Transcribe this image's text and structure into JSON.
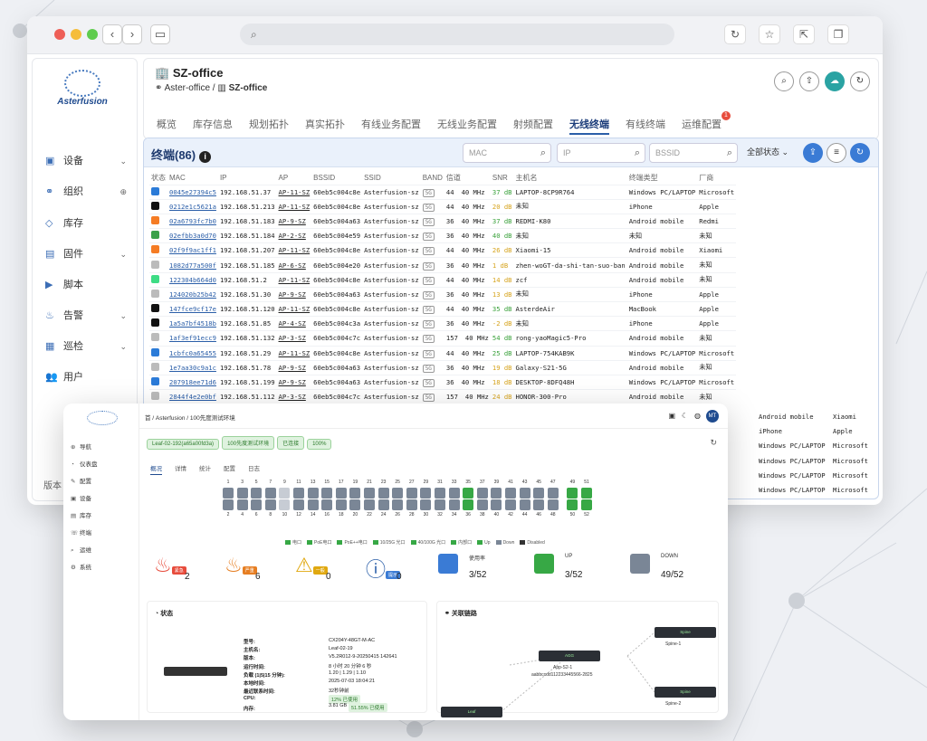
{
  "browser": {
    "url": "",
    "icons": [
      "back-icon",
      "forward-icon",
      "sidebar-icon",
      "reload-icon",
      "star-icon",
      "share-icon",
      "copy-icon"
    ]
  },
  "sidebar": {
    "brand": "Asterfusion",
    "items": [
      {
        "label": "设备",
        "icon": "device-icon",
        "arrow": true
      },
      {
        "label": "组织",
        "icon": "org-icon",
        "plus": true
      },
      {
        "label": "库存",
        "icon": "tag-icon"
      },
      {
        "label": "固件",
        "icon": "firmware-icon",
        "arrow": true
      },
      {
        "label": "脚本",
        "icon": "script-icon"
      },
      {
        "label": "告警",
        "icon": "alarm-icon",
        "arrow": true
      },
      {
        "label": "巡检",
        "icon": "inspect-icon",
        "arrow": true
      },
      {
        "label": "用户",
        "icon": "users-icon"
      }
    ],
    "version": "版本"
  },
  "header": {
    "site": "SZ-office",
    "crumb_root": "Aster-office",
    "crumb_current": "SZ-office",
    "tabs": [
      "概览",
      "库存信息",
      "规划拓扑",
      "真实拓扑",
      "有线业务配置",
      "无线业务配置",
      "射频配置",
      "无线终端",
      "有线终端",
      "运维配置"
    ],
    "active_tab": "无线终端",
    "badge": "1"
  },
  "panel": {
    "title": "终端(86)",
    "mac_placeholder": "MAC",
    "ip_placeholder": "IP",
    "bssid_placeholder": "BSSID",
    "status_filter": "全部状态"
  },
  "table": {
    "headers": [
      "状态",
      "MAC",
      "IP",
      "AP",
      "BSSID",
      "SSID",
      "BAND",
      "信道",
      "SNR",
      "主机名",
      "终端类型",
      "厂商"
    ],
    "rows": [
      [
        "win",
        "0045e27394c5",
        "192.168.51.37",
        "AP-11-SZ",
        "60eb5c004c8e",
        "Asterfusion-sz",
        "5G",
        "44",
        "40 MHz",
        "37 dB",
        "g",
        "LAPTOP-8CP9R764",
        "Windows PC/LAPTOP",
        "Microsoft"
      ],
      [
        "apple",
        "0212e1c5621a",
        "192.168.51.213",
        "AP-11-SZ",
        "60eb5c004c8e",
        "Asterfusion-sz",
        "5G",
        "44",
        "40 MHz",
        "20 dB",
        "y",
        "未知",
        "iPhone",
        "Apple"
      ],
      [
        "mi",
        "02a6793fc7b0",
        "192.168.51.183",
        "AP-9-SZ",
        "60eb5c004a63",
        "Asterfusion-sz",
        "5G",
        "36",
        "40 MHz",
        "37 dB",
        "g",
        "REDMI-K80",
        "Android mobile",
        "Redmi"
      ],
      [
        "wifi",
        "02efbb3a0d70",
        "192.168.51.184",
        "AP-2-SZ",
        "60eb5c004e59",
        "Asterfusion-sz",
        "5G",
        "36",
        "40 MHz",
        "40 dB",
        "g",
        "未知",
        "未知",
        "未知"
      ],
      [
        "mi",
        "02f9f9ac1ff1",
        "192.168.51.207",
        "AP-11-SZ",
        "60eb5c004c8e",
        "Asterfusion-sz",
        "5G",
        "44",
        "40 MHz",
        "26 dB",
        "y",
        "Xiaomi-15",
        "Android mobile",
        "Xiaomi"
      ],
      [
        "dash",
        "1082d77a500f",
        "192.168.51.185",
        "AP-6-SZ",
        "60eb5c004e20",
        "Asterfusion-sz",
        "5G",
        "36",
        "40 MHz",
        "1 dB",
        "y",
        "zhen-woGT-da-shi-tan-suo-ban",
        "Android mobile",
        "未知"
      ],
      [
        "android",
        "122304b664d0",
        "192.168.51.2",
        "AP-11-SZ",
        "60eb5c004c8e",
        "Asterfusion-sz",
        "5G",
        "44",
        "40 MHz",
        "14 dB",
        "y",
        "zcf",
        "Android mobile",
        "未知"
      ],
      [
        "dash",
        "124020b25b42",
        "192.168.51.30",
        "AP-9-SZ",
        "60eb5c004a63",
        "Asterfusion-sz",
        "5G",
        "36",
        "40 MHz",
        "13 dB",
        "y",
        "未知",
        "iPhone",
        "Apple"
      ],
      [
        "apple",
        "147fce9cf17e",
        "192.168.51.120",
        "AP-11-SZ",
        "60eb5c004c8e",
        "Asterfusion-sz",
        "5G",
        "44",
        "40 MHz",
        "35 dB",
        "g",
        "AsterdeAir",
        "MacBook",
        "Apple"
      ],
      [
        "apple",
        "1a5a7bf4518b",
        "192.168.51.85",
        "AP-4-SZ",
        "60eb5c004c3a",
        "Asterfusion-sz",
        "5G",
        "36",
        "40 MHz",
        "-2 dB",
        "y",
        "未知",
        "iPhone",
        "Apple"
      ],
      [
        "dash",
        "1af3ef91ecc9",
        "192.168.51.132",
        "AP-3-SZ",
        "60eb5c004c7c",
        "Asterfusion-sz",
        "5G",
        "157",
        "40 MHz",
        "54 dB",
        "g",
        "rong-yaoMagic5-Pro",
        "Android mobile",
        "未知"
      ],
      [
        "win",
        "1cbfc0a65455",
        "192.168.51.29",
        "AP-11-SZ",
        "60eb5c004c8e",
        "Asterfusion-sz",
        "5G",
        "44",
        "40 MHz",
        "25 dB",
        "g",
        "LAPTOP-754KAB9K",
        "Windows PC/LAPTOP",
        "Microsoft"
      ],
      [
        "dash",
        "1e7aa30c9a1c",
        "192.168.51.78",
        "AP-9-SZ",
        "60eb5c004a63",
        "Asterfusion-sz",
        "5G",
        "36",
        "40 MHz",
        "19 dB",
        "y",
        "Galaxy-S21-5G",
        "Android mobile",
        "未知"
      ],
      [
        "win",
        "207918ee71d6",
        "192.168.51.199",
        "AP-9-SZ",
        "60eb5c004a63",
        "Asterfusion-sz",
        "5G",
        "36",
        "40 MHz",
        "18 dB",
        "y",
        "DESKTOP-8DFQ48H",
        "Windows PC/LAPTOP",
        "Microsoft"
      ],
      [
        "dash",
        "2844f4e2e0bf",
        "192.168.51.112",
        "AP-3-SZ",
        "60eb5c004c7c",
        "Asterfusion-sz",
        "5G",
        "157",
        "40 MHz",
        "24 dB",
        "y",
        "HONOR-300-Pro",
        "Android mobile",
        "未知"
      ]
    ],
    "overflow": [
      [
        "Android mobile",
        "Xiaomi"
      ],
      [
        "iPhone",
        "Apple"
      ],
      [
        "Windows PC/LAPTOP",
        "Microsoft"
      ],
      [
        "Windows PC/LAPTOP",
        "Microsoft"
      ],
      [
        "Windows PC/LAPTOP",
        "Microsoft"
      ],
      [
        "Windows PC/LAPTOP",
        "Microsoft"
      ]
    ]
  },
  "front": {
    "crumb": "首 / Asterfusion / 100先度测试环境",
    "avatar": "MT",
    "side": [
      "导航",
      "仪表盘",
      "配置",
      "设备",
      "库存",
      "终端",
      "运维",
      "系统"
    ],
    "tags": [
      "Leaf-02-192(a65a00fd3a)",
      "100先度测试环境",
      "已连接",
      "100%"
    ],
    "tabs": [
      "概况",
      "详情",
      "统计",
      "配置",
      "日志"
    ],
    "ports_top": [
      "1",
      "3",
      "5",
      "7",
      "9",
      "11",
      "13",
      "15",
      "17",
      "19",
      "21",
      "23",
      "25",
      "27",
      "29",
      "31",
      "33",
      "35",
      "37",
      "39",
      "41",
      "43",
      "45",
      "47",
      "49",
      "51"
    ],
    "ports_bot": [
      "2",
      "4",
      "6",
      "8",
      "10",
      "12",
      "14",
      "16",
      "18",
      "20",
      "22",
      "24",
      "26",
      "28",
      "30",
      "32",
      "34",
      "36",
      "38",
      "40",
      "42",
      "44",
      "46",
      "48",
      "50",
      "52"
    ],
    "legend": [
      "电口",
      "PoE电口",
      "PoE++电口",
      "10/25G 光口",
      "40/100G 光口",
      "内部口",
      "Up",
      "Down",
      "Disabled"
    ],
    "cards": [
      {
        "n": "2",
        "tag": "紧急"
      },
      {
        "n": "6",
        "tag": "严重"
      },
      {
        "n": "0",
        "tag": "一般"
      },
      {
        "n": "0",
        "tag": "提示"
      },
      {
        "label": "使用率",
        "n": "3/52"
      },
      {
        "label": "UP",
        "n": "3/52"
      },
      {
        "label": "DOWN",
        "n": "49/52"
      }
    ],
    "status": {
      "title": "状态",
      "keys": [
        "型号:",
        "主机名:",
        "版本:",
        "运行时间:",
        "负载 (1|5|15 分钟):",
        "本地时间:",
        "最近联系时间:",
        "CPU:",
        "内存:"
      ],
      "vals": [
        "CX204Y-48GT-M-AC",
        "Leaf-02-19",
        "V5.2R012-9-20250415 142641",
        "8 小时 20 分钟 6 秒",
        "1.20 | 1.29 | 1.10",
        "2025-07-03 18:04:21",
        "32秒钟前",
        "12% 已使用",
        "3.81 GB",
        "51.55% 已使用"
      ]
    },
    "topo": {
      "title": "关联链路",
      "nodes": [
        "Spine",
        "Spine-1",
        "Spine-2",
        "AGG",
        "App-S2-1",
        "Leaf",
        "aabbccdd112233445566-2825"
      ]
    }
  }
}
